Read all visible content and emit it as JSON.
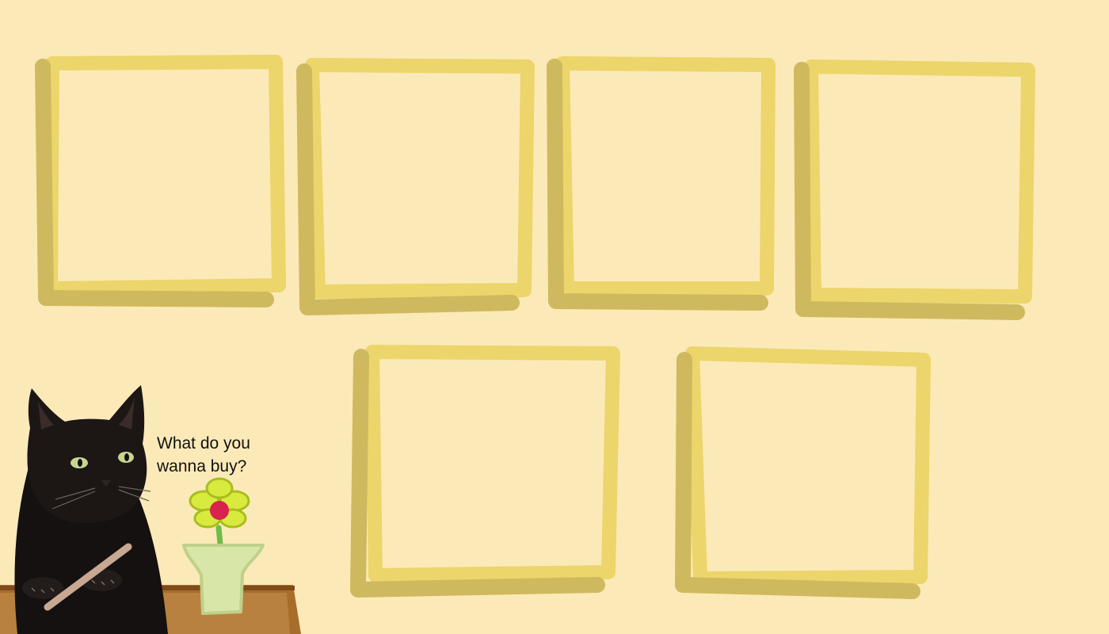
{
  "shopkeeper": {
    "speech": "What do you wanna buy?"
  },
  "shop_slots": [
    {
      "item": ""
    },
    {
      "item": ""
    },
    {
      "item": ""
    },
    {
      "item": ""
    },
    {
      "item": ""
    },
    {
      "item": ""
    }
  ],
  "colors": {
    "background": "#fbeab8",
    "frame_light": "#ecd56a",
    "frame_shadow": "#cfb95e",
    "table": "#b8813f",
    "vase": "#d8e6a8",
    "flower_petal": "#d9ea3e",
    "flower_center": "#d8234e"
  },
  "icons": {
    "shopkeeper": "black-cat-icon",
    "decoration": "flower-vase-icon"
  }
}
